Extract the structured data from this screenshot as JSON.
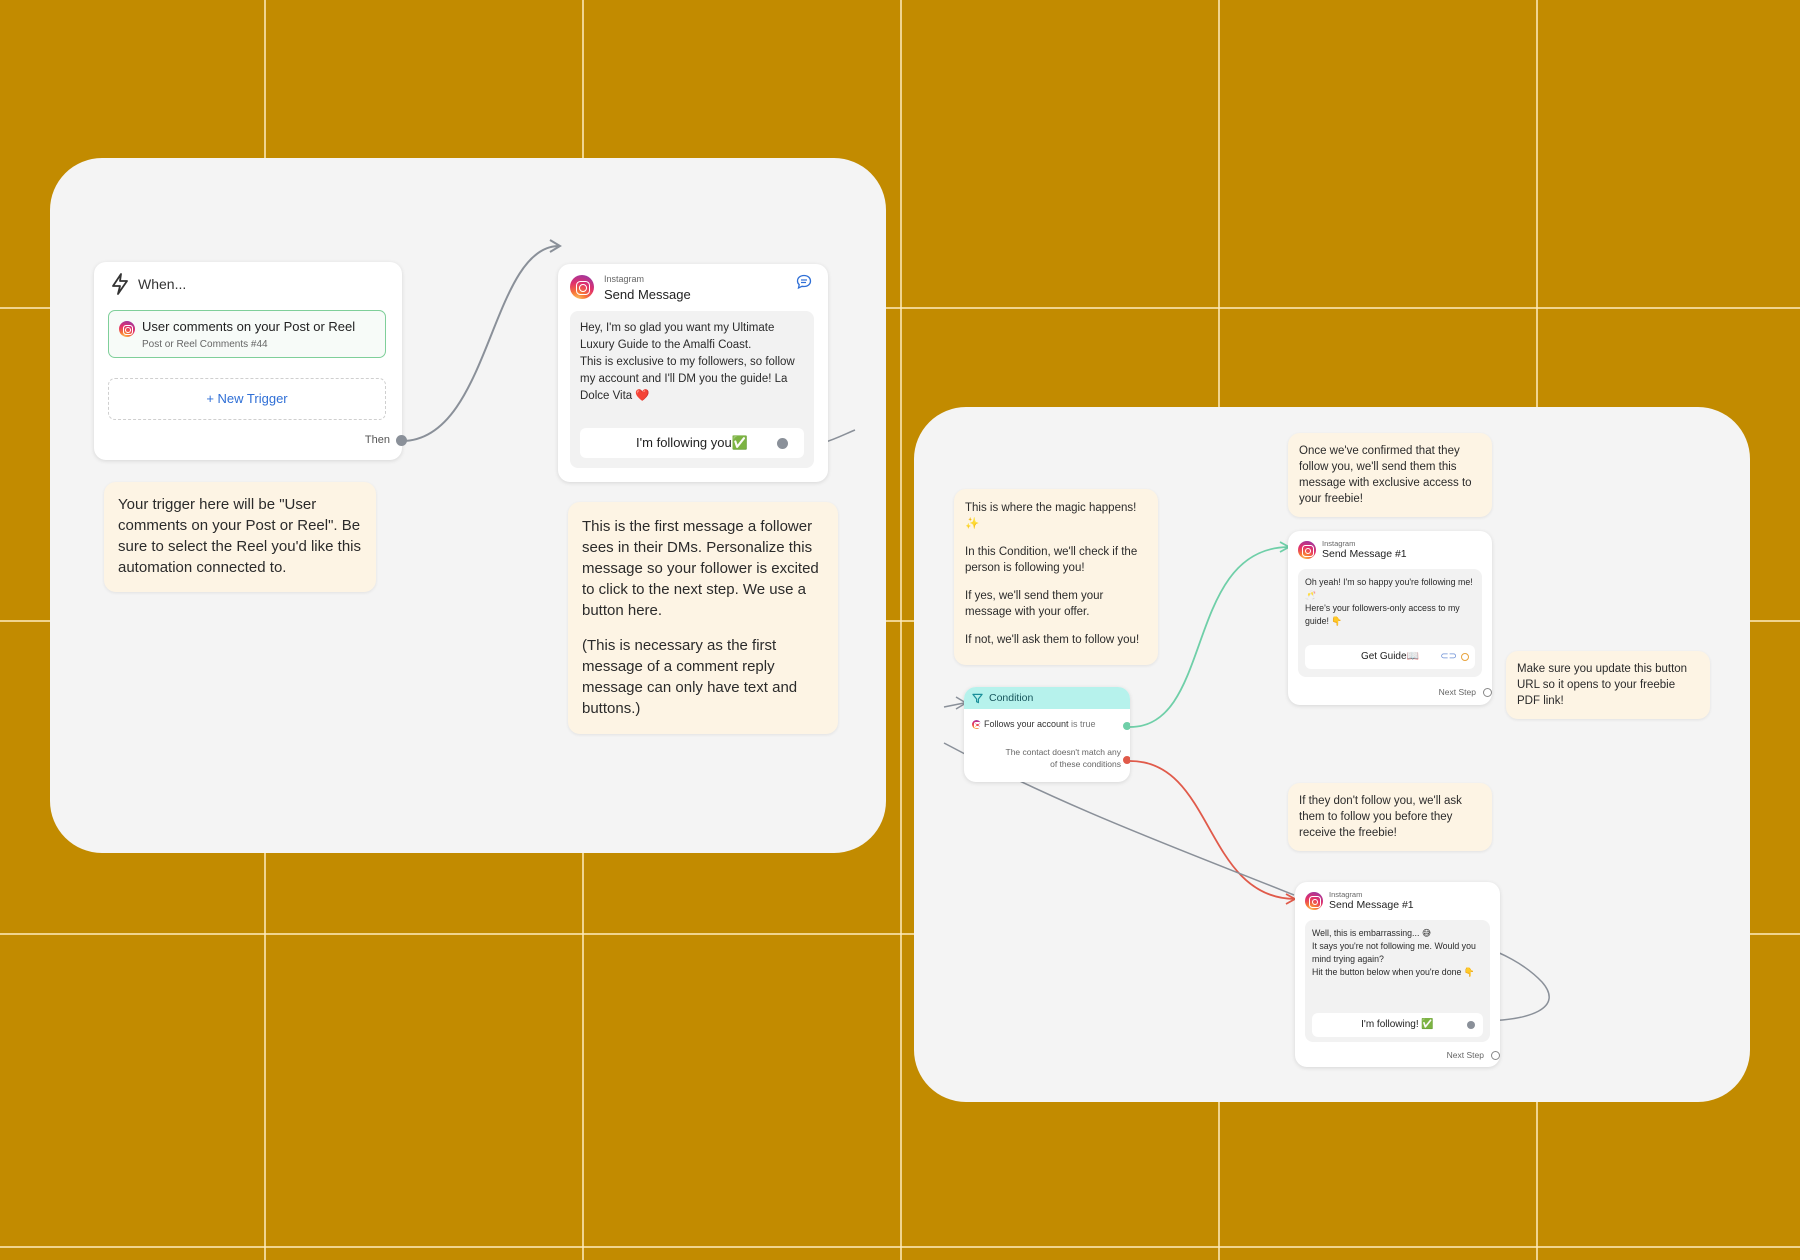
{
  "trigger_card": {
    "title": "When...",
    "trigger_label": "User comments on your Post or Reel",
    "trigger_sub": "Post or Reel Comments #44",
    "new_trigger": "+ New Trigger",
    "then_label": "Then"
  },
  "trigger_note": "Your trigger here will be \"User comments on your Post or Reel\". Be sure to select the Reel you'd like this automation connected to.",
  "send_message_card": {
    "platform": "Instagram",
    "title": "Send Message",
    "paragraph_1": "Hey, I'm so glad you want my Ultimate Luxury Guide to the Amalfi Coast.",
    "paragraph_2": "This is exclusive to my followers, so follow my account and I'll DM you the guide! La Dolce Vita ❤️",
    "button_label": "I'm following you✅"
  },
  "first_message_note": {
    "paragraph_1": "This is the first message a follower sees in their DMs. Personalize this message so your follower is excited to click to the next step. We use a button here.",
    "paragraph_2": "(This is necessary as the first message of a comment reply message can only have text and buttons.)"
  },
  "magic_note": {
    "line_1": "This is where the magic happens! ✨",
    "line_2": "In this Condition, we'll check if the person is following you!",
    "line_3": "If yes, we'll send them your message with your offer.",
    "line_4": "If not, we'll ask them to follow you!"
  },
  "condition_card": {
    "title": "Condition",
    "rule_label": "Follows your account",
    "rule_suffix": " is true",
    "else_line_1": "The contact doesn't match any",
    "else_line_2": "of these conditions"
  },
  "confirm_note": "Once we've confirmed that they follow you, we'll send them this message with exclusive access to your freebie!",
  "yes_message_card": {
    "platform": "Instagram",
    "title": "Send Message #1",
    "paragraph_1": "Oh yeah! I'm so happy you're following me!🥂",
    "paragraph_2": "Here's your followers-only access to my guide! 👇",
    "button_label": "Get Guide📖",
    "next_step": "Next Step"
  },
  "url_note": "Make sure you update this button URL so it opens to your freebie PDF link!",
  "not_follow_note": "If they don't follow you, we'll ask them to follow you before they receive the freebie!",
  "no_message_card": {
    "platform": "Instagram",
    "title": "Send Message #1",
    "paragraph_1": "Well, this is embarrassing... 😅",
    "paragraph_2": "It says you're not following me. Would you mind trying again?",
    "paragraph_3": "Hit the button below when you're done 👇",
    "button_label": "I'm following! ✅",
    "next_step": "Next Step"
  },
  "colors": {
    "background": "#c28b00",
    "panel": "#f4f4f4",
    "note": "#fdf4e4",
    "trigger_border": "#7fcf9a",
    "condition_header": "#b6f2ec",
    "link_blue": "#2f6fd6",
    "wire_green": "#6fcfa8",
    "wire_red": "#e05a4a",
    "wire_gray": "#8a9099"
  },
  "icons": [
    "lightning-icon",
    "instagram-icon",
    "chat-icon",
    "filter-icon",
    "link-icon"
  ]
}
